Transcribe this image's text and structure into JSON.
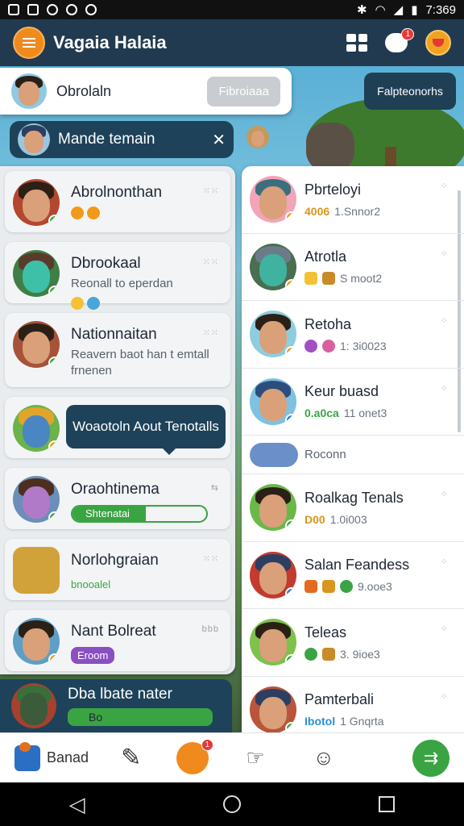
{
  "status_bar": {
    "time": "7:369"
  },
  "header": {
    "title": "Vagaia Halaia",
    "notification_badge": "1"
  },
  "popup": {
    "name": "Obrolaln",
    "button_label": "Fibroiaaa"
  },
  "right_pill": {
    "label": "Falpteonorhs"
  },
  "notice": {
    "text": "Mande temain"
  },
  "left_list": [
    {
      "name": "Abrolnonthan"
    },
    {
      "name": "Dbrookaal",
      "sub": "Reonall to eperdan"
    },
    {
      "name": "Nationnaitan",
      "sub": "Reavern baot han t emtall frnenen"
    },
    {
      "tip": "Woaotoln Aout Tenotalls"
    },
    {
      "name": "Oraohtinema",
      "progress_label": "Shtenatai"
    },
    {
      "name": "Norlohgraian",
      "chip": "bnooalel"
    },
    {
      "name": "Nant Bolreat",
      "chip": "Eroom",
      "dots": "bbb"
    }
  ],
  "bottom_left": {
    "name": "Dba lbate nater",
    "bar_label": "Bo"
  },
  "right_list": [
    {
      "name": "Pbrteloyi",
      "meta_bold": "4006",
      "meta": "1.Snnor2"
    },
    {
      "name": "Atrotla",
      "meta": "S moot2"
    },
    {
      "name": "Retoha",
      "meta": "1: 3i0023"
    },
    {
      "name": "Keur buasd",
      "meta_bold": "0.a0ca",
      "meta": "11 onet3"
    },
    {
      "subrow": "Roconn"
    },
    {
      "name": "Roalkag Tenals",
      "meta_bold": "D00",
      "meta": "1.0i003"
    },
    {
      "name": "Salan Feandess",
      "meta": "9.ooe3"
    },
    {
      "name": "Teleas",
      "meta": "3. 9ioe3"
    },
    {
      "name": "Pamterbali",
      "meta_bold": "Ibotol",
      "meta": "1 Gnqrta"
    }
  ],
  "bottom_nav": {
    "home_label": "Banad",
    "badge": "1"
  },
  "colors": {
    "header": "#213a4f",
    "accent_orange": "#f08a1d",
    "green": "#3aa443",
    "dark_panel": "#1d4259"
  }
}
